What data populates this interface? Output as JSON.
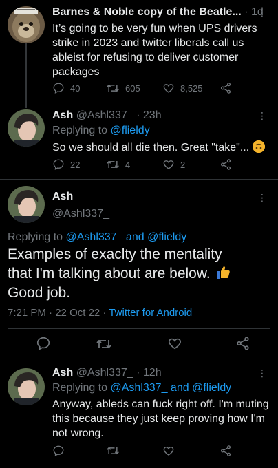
{
  "tweet1": {
    "name": "Barnes & Noble copy of the Beatle...",
    "sep": "·",
    "time": "1d",
    "text": "It’s going to be very fun when UPS drivers strike in 2023 and twitter liberals call us ableist for refusing to deliver customer packages",
    "replies": "40",
    "retweets": "605",
    "likes": "8,525"
  },
  "tweet2": {
    "name": "Ash",
    "handle": "@Ashl337_",
    "sep": "·",
    "time": "23h",
    "replying_prefix": "Replying to",
    "replying_to": "@flieldy",
    "text": "So we should all die then. Great \"take\"...",
    "emoji": "upside-down-face",
    "replies": "22",
    "retweets": "4",
    "likes": "2"
  },
  "main": {
    "name": "Ash",
    "handle": "@Ashl337_",
    "replying_prefix": "Replying to",
    "replying_to_1": "@Ashl337_",
    "and": "and",
    "replying_to_2": "@flieldy",
    "text": "Examples of exaclty the mentality that I'm talking about are below.",
    "text_end": "Good job.",
    "emoji": "thumbs-up",
    "time": "7:21 PM",
    "sep1": "·",
    "date": "22 Oct 22",
    "sep2": "·",
    "source": "Twitter for Android"
  },
  "tweet3": {
    "name": "Ash",
    "handle": "@Ashl337_",
    "sep": "·",
    "time": "12h",
    "replying_prefix": "Replying to",
    "replying_to_1": "@Ashl337_",
    "and": "and",
    "replying_to_2": "@flieldy",
    "text": "Anyway, ableds can fuck right off. I'm muting this because they just keep proving how I'm not wrong."
  },
  "more_glyph": "⋮",
  "colors": {
    "accent": "#1d9bf0",
    "muted": "#71767b",
    "background": "#000000",
    "text": "#e7e9ea"
  }
}
